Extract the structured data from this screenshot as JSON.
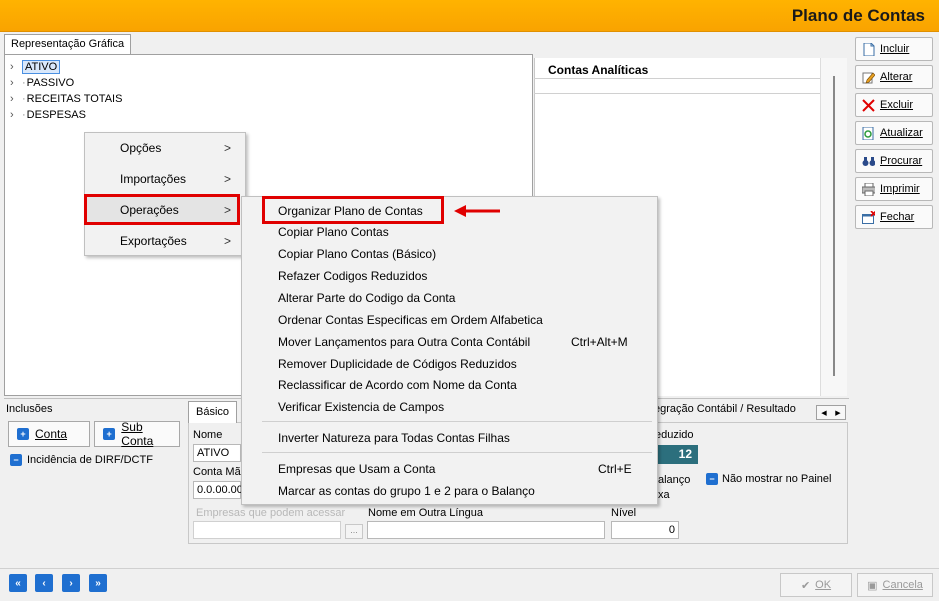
{
  "window": {
    "title": "Plano de Contas"
  },
  "tabs": {
    "representacao": "Representação Gráfica"
  },
  "tree": [
    {
      "label": "ATIVO"
    },
    {
      "label": "PASSIVO"
    },
    {
      "label": "RECEITAS TOTAIS"
    },
    {
      "label": "DESPESAS"
    }
  ],
  "contas_analiticas": {
    "header": "Contas Analíticas"
  },
  "toolbar": [
    {
      "label": "Incluir",
      "icon": "new-document-icon"
    },
    {
      "label": "Alterar",
      "icon": "edit-icon"
    },
    {
      "label": "Excluir",
      "icon": "delete-x-icon"
    },
    {
      "label": "Atualizar",
      "icon": "refresh-icon"
    },
    {
      "label": "Procurar",
      "icon": "binoculars-icon"
    },
    {
      "label": "Imprimir",
      "icon": "printer-icon"
    },
    {
      "label": "Fechar",
      "icon": "close-window-icon"
    }
  ],
  "context_menu": {
    "items": [
      {
        "label": "Opções",
        "arrow": ">"
      },
      {
        "label": "Importações",
        "arrow": ">"
      },
      {
        "label": "Operações",
        "arrow": ">"
      },
      {
        "label": "Exportações",
        "arrow": ">"
      }
    ]
  },
  "submenu": {
    "items": [
      {
        "label": "Organizar Plano de Contas",
        "shortcut": ""
      },
      {
        "label": "Copiar Plano Contas",
        "shortcut": ""
      },
      {
        "label": "Copiar Plano Contas (Básico)",
        "shortcut": ""
      },
      {
        "label": "Refazer Codigos Reduzidos",
        "shortcut": ""
      },
      {
        "label": "Alterar Parte do Codigo da Conta",
        "shortcut": ""
      },
      {
        "label": "Ordenar Contas Especificas em Ordem Alfabetica",
        "shortcut": ""
      },
      {
        "label": "Mover Lançamentos para Outra Conta Contábil",
        "shortcut": "Ctrl+Alt+M"
      },
      {
        "label": "Remover Duplicidade de Códigos Reduzidos",
        "shortcut": ""
      },
      {
        "label": "Reclassificar de Acordo com Nome da Conta",
        "shortcut": ""
      },
      {
        "label": "Verificar Existencia de Campos",
        "shortcut": ""
      },
      {
        "label": "Inverter Natureza para Todas Contas Filhas",
        "shortcut": ""
      },
      {
        "label": "Empresas que Usam a Conta",
        "shortcut": "Ctrl+E"
      },
      {
        "label": "Marcar as contas do grupo 1 e 2 para o Balanço",
        "shortcut": ""
      }
    ]
  },
  "inclusoes": {
    "label": "Inclusões",
    "conta_button": "Conta",
    "subconta_button": "Sub Conta",
    "dirf_label": "Incidência de DIRF/DCTF"
  },
  "details": {
    "tab_basico": "Básico",
    "tab_integracao": "egração Contábil / Resultado",
    "nome_label": "Nome",
    "nome_value": "ATIVO",
    "conta_mae_label": "Conta Mãe",
    "conta_mae_value": "0.0.00.00",
    "reduzido_label": "eduzido",
    "reduzido_value": "12",
    "balanco_label": "alanço",
    "xa_label": "xa",
    "nao_mostrar_label": "Não mostrar no Painel",
    "empresas_label": "Empresas que podem acessar",
    "ellipsis": "...",
    "nome_outra_lingua_label": "Nome em Outra Língua",
    "nivel_label": "Nível",
    "nivel_value": "0"
  },
  "footer": {
    "nav": [
      "«",
      "‹",
      "›",
      "»"
    ],
    "ok": "OK",
    "cancel": "Cancela"
  },
  "colors": {
    "title_bar": "#f9a300",
    "highlight": "#e00000",
    "accent": "#1f6fd0"
  }
}
